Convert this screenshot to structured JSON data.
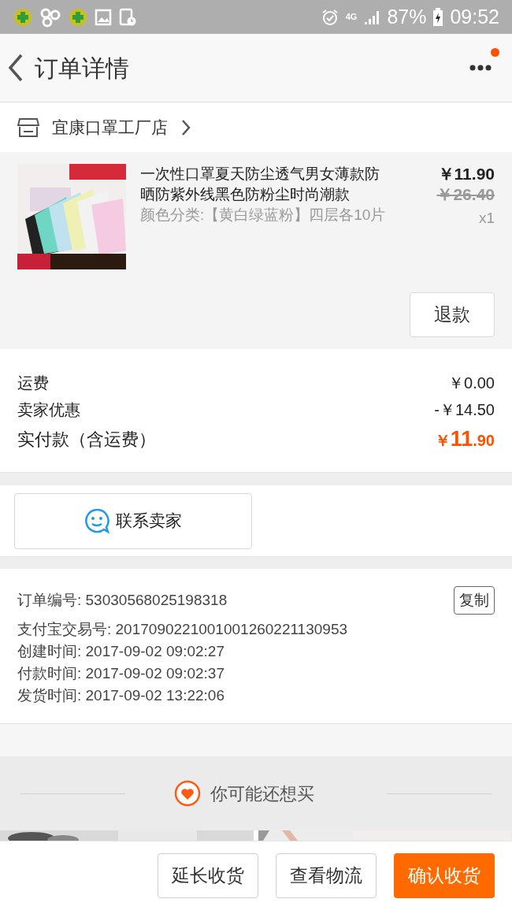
{
  "status_bar": {
    "network": "4G",
    "battery": "87%",
    "time": "09:52"
  },
  "header": {
    "title": "订单详情",
    "notification_dot": true
  },
  "shop": {
    "name": "宜康口罩工厂店"
  },
  "item": {
    "kind": "picture",
    "title": "一次性口罩夏天防尘透气男女薄款防晒防紫外线黑色防粉尘时尚潮款",
    "variant": "颜色分类:【黄白绿蓝粉】四层各10片",
    "price": "￥11.90",
    "original_price": "￥26.40",
    "quantity": "x1",
    "action": "退款"
  },
  "fees": [
    {
      "label": "运费",
      "value": "￥0.00"
    },
    {
      "label": "卖家优惠",
      "value": "-￥14.50"
    }
  ],
  "total": {
    "label": "实付款（含运费）",
    "currency": "￥",
    "integer": "11",
    "decimal": ".90"
  },
  "contact_button": "联系卖家",
  "order_info": {
    "copy_button": "复制",
    "lines": [
      "订单编号: 53030568025198318",
      "支付宝交易号: 2017090221001001260221130953",
      "创建时间: 2017-09-02 09:02:27",
      "付款时间: 2017-09-02 09:02:37",
      "发货时间: 2017-09-02 13:22:06"
    ]
  },
  "recommend": {
    "title": "你可能还想买"
  },
  "bottom_actions": [
    {
      "label": "延长收货",
      "primary": false
    },
    {
      "label": "查看物流",
      "primary": false
    },
    {
      "label": "确认收货",
      "primary": true
    }
  ]
}
